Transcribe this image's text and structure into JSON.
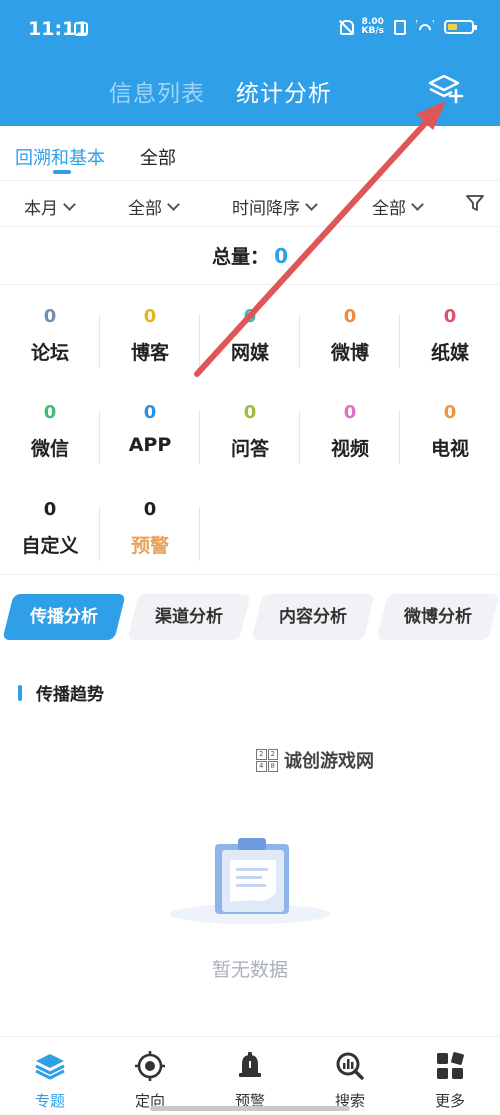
{
  "status_bar": {
    "time": "11:11",
    "net_speed_value": "8.00",
    "net_speed_unit": "KB/s"
  },
  "header": {
    "tabs": [
      "信息列表",
      "统计分析"
    ],
    "active_tab": "统计分析"
  },
  "sub_tabs": {
    "items": [
      "回溯和基本",
      "全部"
    ],
    "active": "回溯和基本"
  },
  "filters": {
    "month": "本月",
    "scope": "全部",
    "sort": "时间降序",
    "category": "全部"
  },
  "total": {
    "label": "总量：",
    "value": "0"
  },
  "stats": [
    {
      "name": "论坛",
      "value": "0",
      "color": "#6f8fb0"
    },
    {
      "name": "博客",
      "value": "0",
      "color": "#e8b21e"
    },
    {
      "name": "网媒",
      "value": "0",
      "color": "#3fb8b0"
    },
    {
      "name": "微博",
      "value": "0",
      "color": "#f08a3c"
    },
    {
      "name": "纸媒",
      "value": "0",
      "color": "#e04f6c"
    },
    {
      "name": "微信",
      "value": "0",
      "color": "#3cbf72"
    },
    {
      "name": "APP",
      "value": "0",
      "color": "#2f8fd8"
    },
    {
      "name": "问答",
      "value": "0",
      "color": "#9bbd3a"
    },
    {
      "name": "视频",
      "value": "0",
      "color": "#e070c8"
    },
    {
      "name": "电视",
      "value": "0",
      "color": "#f0963c"
    },
    {
      "name": "自定义",
      "value": "0",
      "color": "#222222"
    },
    {
      "name": "预警",
      "value": "0",
      "color": "#222222",
      "name_color": "#e8a25a"
    }
  ],
  "analysis_tabs": {
    "items": [
      "传播分析",
      "渠道分析",
      "内容分析",
      "微博分析"
    ],
    "active": "传播分析"
  },
  "section": {
    "title": "传播趋势"
  },
  "watermark": {
    "text": "诚创游戏网",
    "logo_digits": [
      "2",
      "2",
      "4",
      "8"
    ]
  },
  "empty_state": {
    "text": "暂无数据"
  },
  "bottom_nav": {
    "items": [
      {
        "label": "专题",
        "icon": "layers-icon"
      },
      {
        "label": "定向",
        "icon": "target-icon"
      },
      {
        "label": "预警",
        "icon": "bell-icon"
      },
      {
        "label": "搜索",
        "icon": "search-chart-icon"
      },
      {
        "label": "更多",
        "icon": "grid-icon"
      }
    ],
    "active": "专题"
  },
  "colors": {
    "accent": "#2f9fe8",
    "annotation": "#e05656"
  }
}
